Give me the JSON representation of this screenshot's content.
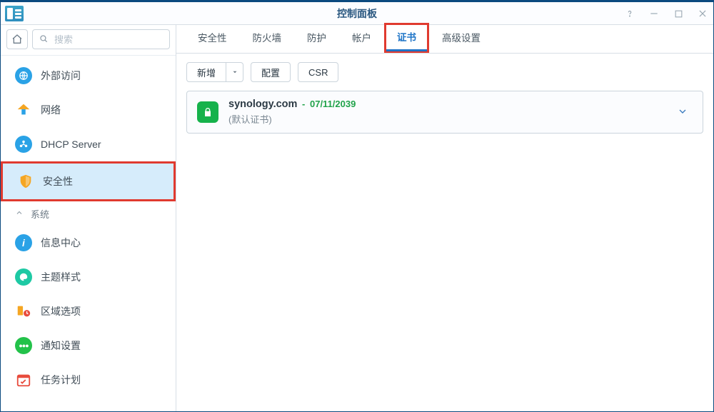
{
  "window": {
    "title": "控制面板"
  },
  "search": {
    "placeholder": "搜索"
  },
  "sidebar": {
    "items": [
      {
        "label": "外部访问"
      },
      {
        "label": "网络"
      },
      {
        "label": "DHCP Server"
      },
      {
        "label": "安全性"
      }
    ],
    "group_label": "系统",
    "system_items": [
      {
        "label": "信息中心"
      },
      {
        "label": "主题样式"
      },
      {
        "label": "区域选项"
      },
      {
        "label": "通知设置"
      },
      {
        "label": "任务计划"
      }
    ]
  },
  "tabs": [
    {
      "label": "安全性"
    },
    {
      "label": "防火墙"
    },
    {
      "label": "防护"
    },
    {
      "label": "帐户"
    },
    {
      "label": "证书"
    },
    {
      "label": "高级设置"
    }
  ],
  "toolbar": {
    "add_label": "新增",
    "config_label": "配置",
    "csr_label": "CSR"
  },
  "cert": {
    "domain": "synology.com",
    "sep": " - ",
    "expiry": "07/11/2039",
    "subtitle": "(默认证书)"
  }
}
